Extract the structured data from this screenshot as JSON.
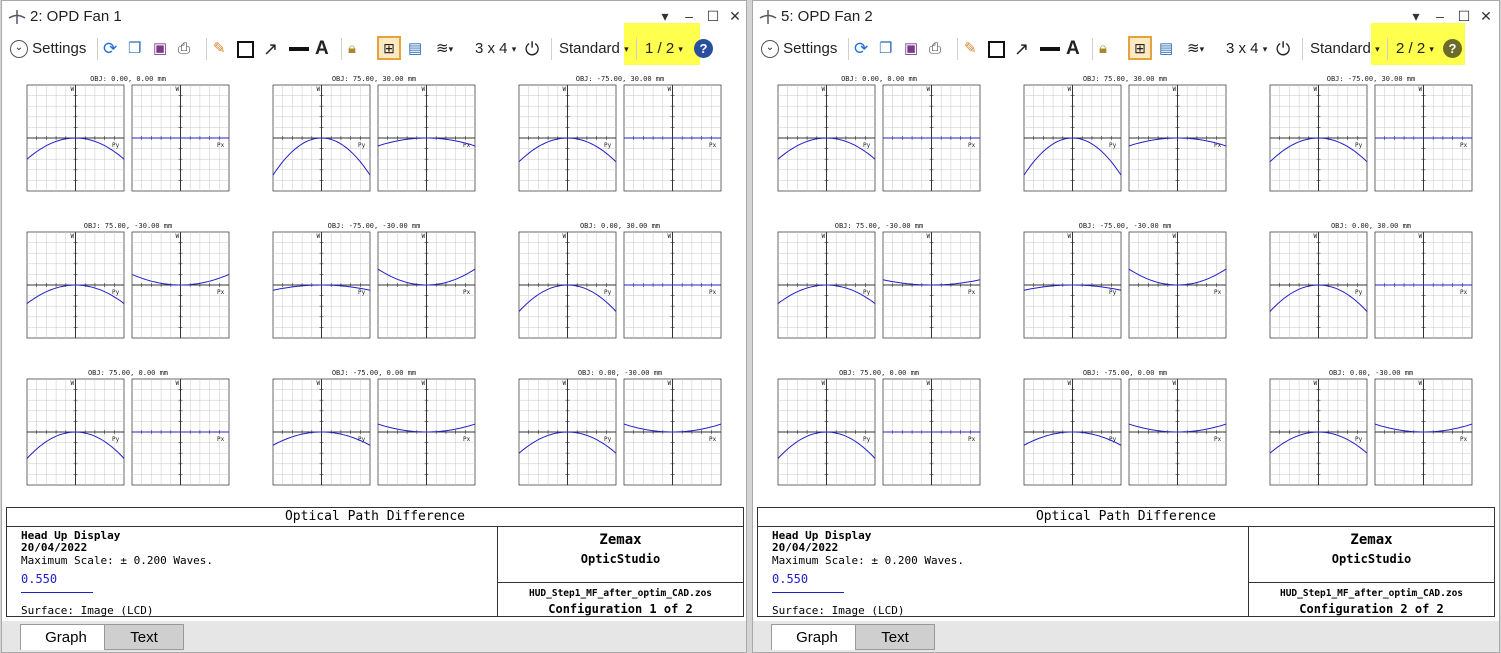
{
  "windows": [
    {
      "title": "2: OPD Fan 1",
      "toolbar": {
        "settings_label": "Settings",
        "layout_label": "3 x 4",
        "standard_label": "Standard",
        "page_label": "1 / 2"
      },
      "plot_titles": [
        "OBJ: 0.00, 0.00 mm",
        "OBJ: 75.00, 30.00 mm",
        "OBJ: -75.00, 30.00 mm",
        "OBJ: 75.00, -30.00 mm",
        "OBJ: -75.00, -30.00 mm",
        "OBJ: 0.00, 30.00 mm",
        "OBJ: 75.00, 0.00 mm",
        "OBJ: -75.00, 0.00 mm",
        "OBJ: 0.00, -30.00 mm"
      ],
      "footer": {
        "heading": "Optical Path Difference",
        "project": "Head Up Display",
        "date": "20/04/2022",
        "scale": "Maximum Scale: ± 0.200 Waves.",
        "wavelength": "0.550",
        "surface": "Surface: Image (LCD)",
        "brand1": "Zemax",
        "brand2": "OpticStudio",
        "file": "HUD_Step1_MF_after_optim_CAD.zos",
        "config": "Configuration 1 of 2"
      },
      "tabs": [
        "Graph",
        "Text"
      ]
    },
    {
      "title": "5: OPD Fan 2",
      "toolbar": {
        "settings_label": "Settings",
        "layout_label": "3 x 4",
        "standard_label": "Standard",
        "page_label": "2 / 2"
      },
      "plot_titles": [
        "OBJ: 0.00, 0.00 mm",
        "OBJ: 75.00, 30.00 mm",
        "OBJ: -75.00, 30.00 mm",
        "OBJ: 75.00, -30.00 mm",
        "OBJ: -75.00, -30.00 mm",
        "OBJ: 0.00, 30.00 mm",
        "OBJ: 75.00, 0.00 mm",
        "OBJ: -75.00, 0.00 mm",
        "OBJ: 0.00, -30.00 mm"
      ],
      "footer": {
        "heading": "Optical Path Difference",
        "project": "Head Up Display",
        "date": "20/04/2022",
        "scale": "Maximum Scale: ± 0.200 Waves.",
        "wavelength": "0.550",
        "surface": "Surface: Image (LCD)",
        "brand1": "Zemax",
        "brand2": "OpticStudio",
        "file": "HUD_Step1_MF_after_optim_CAD.zos",
        "config": "Configuration 2 of 2"
      },
      "tabs": [
        "Graph",
        "Text"
      ]
    }
  ],
  "axis_labels": {
    "w": "W",
    "py": "Py",
    "px": "Px"
  },
  "colors": {
    "curve": "#2020c8",
    "grid": "#c8c8c8",
    "highlight": "#ffff4d",
    "accent": "#1e6fd9"
  },
  "chart_data": [
    {
      "type": "line",
      "note_scale": "Maximum Scale: ± 0.200 Waves.",
      "ylim": [
        -0.2,
        0.2
      ],
      "xlim": [
        -1,
        1
      ],
      "fans": [
        {
          "field": "OBJ: 0.00, 0.00 mm",
          "py_curvature": -0.08,
          "px_curvature": 0.0
        },
        {
          "field": "OBJ: 75.00, 30.00 mm",
          "py_curvature": -0.14,
          "px_curvature": -0.03
        },
        {
          "field": "OBJ: -75.00, 30.00 mm",
          "py_curvature": -0.09,
          "px_curvature": 0.0
        },
        {
          "field": "OBJ: 75.00, -30.00 mm",
          "py_curvature": -0.07,
          "px_curvature": 0.04
        },
        {
          "field": "OBJ: -75.00, -30.00 mm",
          "py_curvature": -0.02,
          "px_curvature": 0.06
        },
        {
          "field": "OBJ: 0.00, 30.00 mm",
          "py_curvature": -0.1,
          "px_curvature": 0.0
        },
        {
          "field": "OBJ: 75.00, 0.00 mm",
          "py_curvature": -0.1,
          "px_curvature": 0.0
        },
        {
          "field": "OBJ: -75.00, 0.00 mm",
          "py_curvature": -0.05,
          "px_curvature": 0.03
        },
        {
          "field": "OBJ: 0.00, -30.00 mm",
          "py_curvature": -0.08,
          "px_curvature": 0.03
        }
      ]
    },
    {
      "type": "line",
      "note_scale": "Maximum Scale: ± 0.200 Waves.",
      "ylim": [
        -0.2,
        0.2
      ],
      "xlim": [
        -1,
        1
      ],
      "fans": [
        {
          "field": "OBJ: 0.00, 0.00 mm",
          "py_curvature": -0.08,
          "px_curvature": 0.0
        },
        {
          "field": "OBJ: 75.00, 30.00 mm",
          "py_curvature": -0.14,
          "px_curvature": -0.03
        },
        {
          "field": "OBJ: -75.00, 30.00 mm",
          "py_curvature": -0.09,
          "px_curvature": 0.0
        },
        {
          "field": "OBJ: 75.00, -30.00 mm",
          "py_curvature": -0.07,
          "px_curvature": 0.02
        },
        {
          "field": "OBJ: -75.00, -30.00 mm",
          "py_curvature": -0.02,
          "px_curvature": 0.06
        },
        {
          "field": "OBJ: 0.00, 30.00 mm",
          "py_curvature": -0.1,
          "px_curvature": 0.0
        },
        {
          "field": "OBJ: 75.00, 0.00 mm",
          "py_curvature": -0.1,
          "px_curvature": 0.0
        },
        {
          "field": "OBJ: -75.00, 0.00 mm",
          "py_curvature": -0.05,
          "px_curvature": 0.03
        },
        {
          "field": "OBJ: 0.00, -30.00 mm",
          "py_curvature": -0.08,
          "px_curvature": 0.03
        }
      ]
    }
  ]
}
